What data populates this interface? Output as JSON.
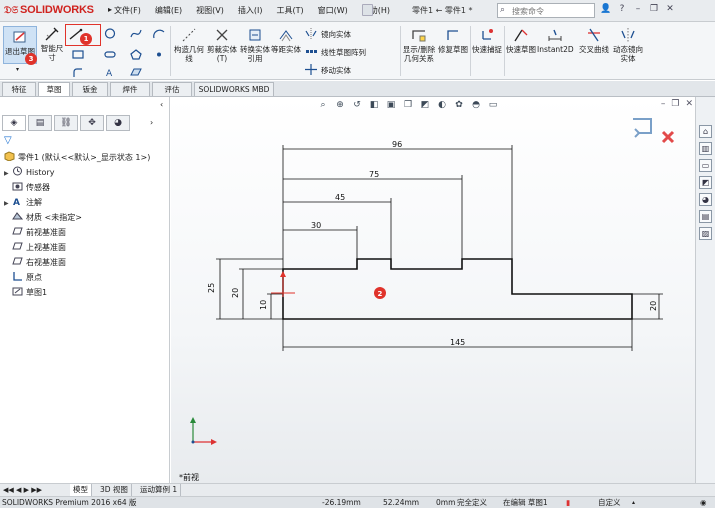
{
  "app": {
    "logo": "SOLIDWORKS",
    "doc_title": "零件1 ← 零件1 *",
    "search_placeholder": "搜索命令"
  },
  "menu": [
    "文件(F)",
    "编辑(E)",
    "视图(V)",
    "插入(I)",
    "工具(T)",
    "窗口(W)",
    "帮助(H)"
  ],
  "ribbon": {
    "exit_sketch": "退出草图",
    "smart_dim": "智能尺寸",
    "construct": "构造几何线",
    "trim": "剪裁实体(T)",
    "convert": "转换实体引用",
    "offset": "等距实体",
    "mirror": "镜向实体",
    "linear_pattern": "线性草图阵列",
    "move": "移动实体",
    "show_relations": "显示/删除几何关系",
    "repair": "修复草图",
    "quick_snap": "快速捕捉",
    "rapid_sketch": "快速草图",
    "instant2d": "Instant2D",
    "intersect": "交叉曲线",
    "dynamic_mirror": "动态镜向实体"
  },
  "callouts": {
    "one": "1",
    "two": "2",
    "three": "3"
  },
  "tabs": [
    "特征",
    "草图",
    "钣金",
    "焊件",
    "评估",
    "SOLIDWORKS MBD"
  ],
  "active_tab": 1,
  "tree": {
    "root": "零件1 (默认<<默认>_显示状态 1>)",
    "items": [
      "History",
      "传感器",
      "注解",
      "材质 <未指定>",
      "前视基准面",
      "上视基准面",
      "右视基准面",
      "原点",
      "草图1"
    ]
  },
  "sketch": {
    "dims": {
      "d96": "96",
      "d75": "75",
      "d45": "45",
      "d30": "30",
      "d25": "25",
      "d20a": "20",
      "d10": "10",
      "d20b": "20",
      "d145": "145"
    },
    "view_name": "*前视"
  },
  "bottom_tabs": [
    "模型",
    "3D 视图",
    "运动算例 1"
  ],
  "status": {
    "product": "SOLIDWORKS Premium 2016 x64 版",
    "x": "-26.19mm",
    "y": "52.24mm",
    "z": "0mm",
    "state": "完全定义",
    "editing": "在编辑 草图1",
    "custom": "自定义"
  },
  "colors": {
    "accent": "#e0332b",
    "sketch": "#111111",
    "logo": "#d0231f"
  }
}
